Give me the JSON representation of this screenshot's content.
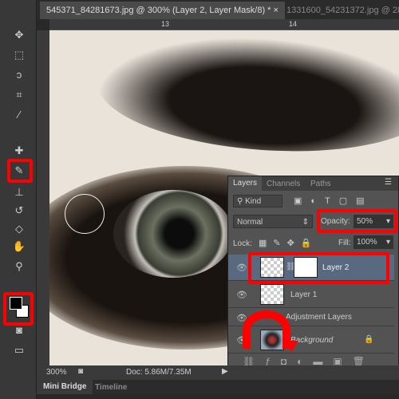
{
  "tabs": [
    {
      "label": "545371_84281673.jpg @ 300% (Layer 2, Layer Mask/8) *",
      "close": "×"
    },
    {
      "label": "1331600_54231372.jpg @ 28.6"
    }
  ],
  "ruler": {
    "marks": [
      "13",
      "14"
    ]
  },
  "tools": [
    "move-icon",
    "marquee-icon",
    "lasso-icon",
    "crop-icon",
    "eyedropper-icon",
    "healing-icon",
    "brush-icon",
    "stamp-icon",
    "history-brush-icon",
    "eraser-icon",
    "gradient-icon",
    "dodge-icon",
    "pen-icon",
    "type-icon",
    "path-select-icon",
    "shape-icon",
    "hand-icon",
    "zoom-icon",
    "color-swatch",
    "quick-mask-icon",
    "screen-mode-icon"
  ],
  "colors": {
    "foreground": "#000000",
    "background": "#ffffff",
    "highlight": "#ff0000",
    "selected_layer": "#596a80"
  },
  "layers_panel": {
    "tabs": [
      "Layers",
      "Channels",
      "Paths"
    ],
    "filter": "Kind",
    "blend_mode": "Normal",
    "opacity_label": "Opacity:",
    "opacity": "50%",
    "lock_label": "Lock:",
    "fill_label": "Fill:",
    "fill": "100%",
    "layers": [
      {
        "name": "Layer 2",
        "selected": true,
        "mask": true
      },
      {
        "name": "Layer 1"
      },
      {
        "name": "Adjustment Layers"
      },
      {
        "name": "Background",
        "locked": true
      }
    ],
    "footer_icons": [
      "link-icon",
      "fx-icon",
      "mask-icon",
      "adjustment-icon",
      "folder-icon",
      "new-layer-icon",
      "trash-icon"
    ]
  },
  "status": {
    "zoom": "300%",
    "doc": "Doc: 5.86M/7.35M"
  },
  "bottom_tabs": [
    "Mini Bridge",
    "Timeline"
  ]
}
